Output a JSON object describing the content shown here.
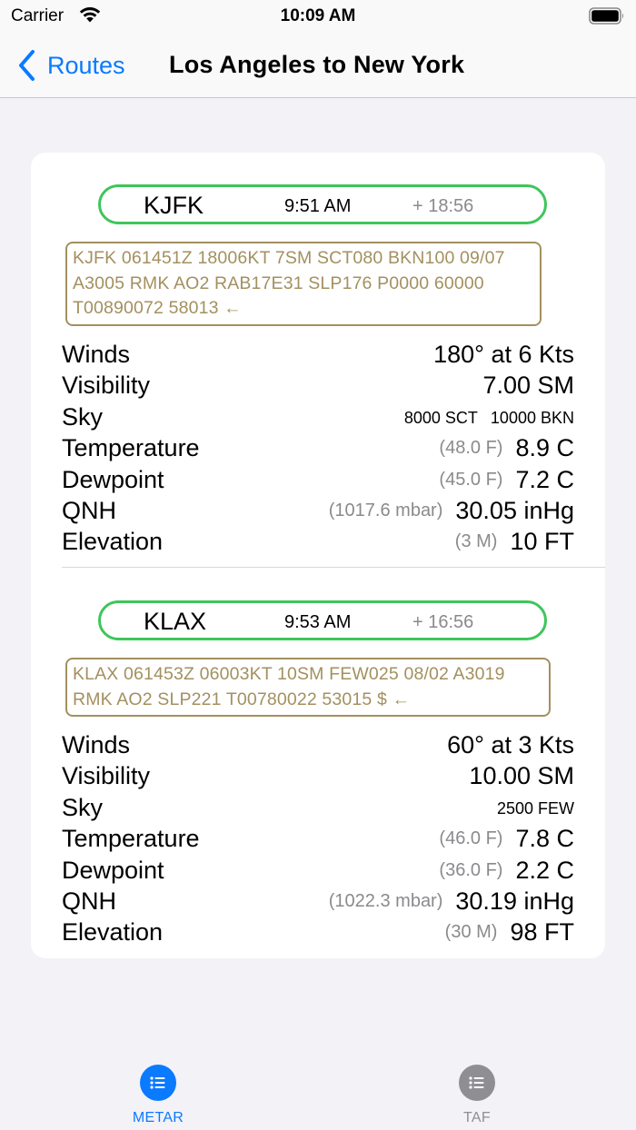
{
  "status_bar": {
    "carrier": "Carrier",
    "time": "10:09 AM"
  },
  "nav": {
    "back_label": "Routes",
    "title": "Los Angeles to New York"
  },
  "stations": [
    {
      "id": "KJFK",
      "time": "9:51 AM",
      "age": "+  18:56",
      "raw_lines": [
        "KJFK 061451Z 18006KT 7SM SCT080 BKN100 09/07",
        "A3005 RMK AO2 RAB17E31 SLP176 P0000 60000",
        "T00890072 58013 ←"
      ],
      "rows": {
        "winds": {
          "label": "Winds",
          "value": "180° at 6 Kts"
        },
        "visibility": {
          "label": "Visibility",
          "value": "7.00 SM"
        },
        "sky": {
          "label": "Sky",
          "layers": [
            "8000 SCT",
            "10000 BKN"
          ]
        },
        "temperature": {
          "label": "Temperature",
          "alt": "(48.0 F)",
          "value": "8.9 C"
        },
        "dewpoint": {
          "label": "Dewpoint",
          "alt": "(45.0 F)",
          "value": "7.2 C"
        },
        "qnh": {
          "label": "QNH",
          "alt": "(1017.6 mbar)",
          "value": "30.05 inHg"
        },
        "elevation": {
          "label": "Elevation",
          "alt": "(3 M)",
          "value": "10 FT"
        }
      }
    },
    {
      "id": "KLAX",
      "time": "9:53 AM",
      "age": "+  16:56",
      "raw_lines": [
        "KLAX 061453Z 06003KT 10SM FEW025 08/02 A3019",
        "RMK AO2 SLP221 T00780022 53015 $ ←"
      ],
      "rows": {
        "winds": {
          "label": "Winds",
          "value": "60° at 3 Kts"
        },
        "visibility": {
          "label": "Visibility",
          "value": "10.00 SM"
        },
        "sky": {
          "label": "Sky",
          "layers": [
            "2500 FEW"
          ]
        },
        "temperature": {
          "label": "Temperature",
          "alt": "(46.0 F)",
          "value": "7.8 C"
        },
        "dewpoint": {
          "label": "Dewpoint",
          "alt": "(36.0 F)",
          "value": "2.2 C"
        },
        "qnh": {
          "label": "QNH",
          "alt": "(1022.3 mbar)",
          "value": "30.19 inHg"
        },
        "elevation": {
          "label": "Elevation",
          "alt": "(30 M)",
          "value": "98 FT"
        }
      }
    }
  ],
  "tabs": [
    {
      "label": "METAR",
      "icon": "list-icon",
      "selected": true
    },
    {
      "label": "TAF",
      "icon": "list-icon",
      "selected": false
    }
  ],
  "colors": {
    "accent": "#0a7aff",
    "pill_border": "#3ec65a",
    "raw_text": "#a3905f",
    "secondary": "#8a8a8e",
    "tab_inactive": "#8e8e93"
  }
}
